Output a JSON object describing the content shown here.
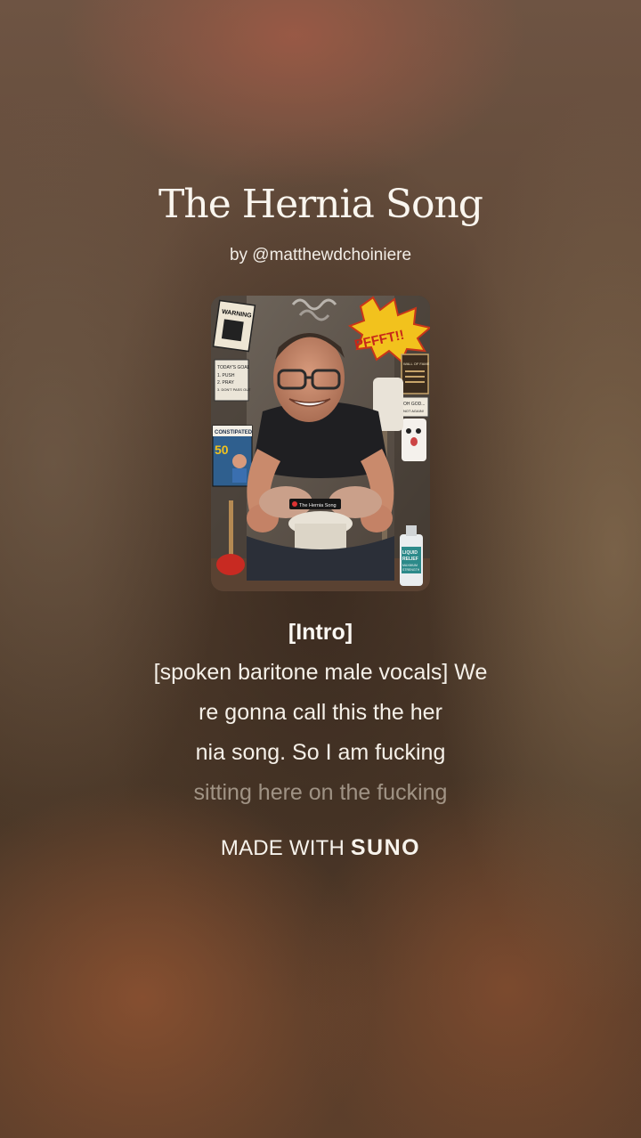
{
  "song": {
    "title": "The Hernia Song",
    "byline": "by @matthewdchoiniere"
  },
  "cover_art": {
    "sign_warning": "WARNING",
    "sign_goal": [
      "TODAY'S GOAL",
      "1. PUSH",
      "2. PRAY",
      "3. DON'T PASS OUT"
    ],
    "poster_constipated": "CONSTIPATED",
    "poster_number": "50",
    "sound_effect": "PFFFT!!",
    "sign_wall": [
      "WALL OF FAME"
    ],
    "sign_oh_god": [
      "OH GOD...",
      "NOT AGAIN!"
    ],
    "label_song": "The Hernia Song",
    "bottle_label": [
      "LIQUID",
      "RELIEF",
      "MAXIMUM",
      "STRENGTH"
    ]
  },
  "lyrics": {
    "section": "[Intro]",
    "lines": [
      "[spoken baritone male vocals] We",
      "re gonna call this the her",
      "nia song. So I am fucking",
      "sitting here on the fucking"
    ]
  },
  "footer": {
    "made_with": "MADE WITH",
    "brand": "SUNO"
  },
  "colors": {
    "text": "#f5f1ea",
    "faded_text": "rgba(235,225,212,0.55)",
    "background_warm": "#5b4331"
  }
}
